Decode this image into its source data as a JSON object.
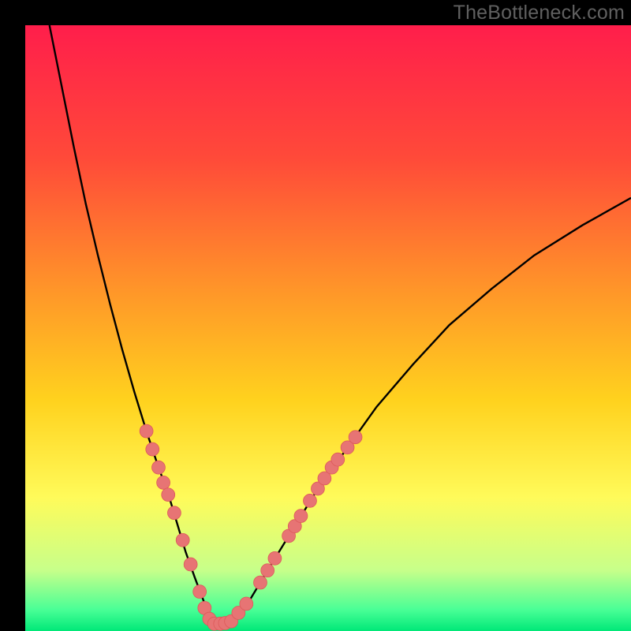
{
  "attribution": "TheBottleneck.com",
  "colors": {
    "frame": "#000000",
    "curve": "#000000",
    "dot_fill": "#e77474",
    "dot_stroke": "#dd5a5a",
    "gradient_stops": [
      {
        "offset": 0.0,
        "color": "#ff1e4b"
      },
      {
        "offset": 0.22,
        "color": "#ff4a39"
      },
      {
        "offset": 0.45,
        "color": "#ff9a28"
      },
      {
        "offset": 0.62,
        "color": "#ffd21e"
      },
      {
        "offset": 0.78,
        "color": "#fffb5a"
      },
      {
        "offset": 0.9,
        "color": "#c7ff8a"
      },
      {
        "offset": 0.965,
        "color": "#49ff96"
      },
      {
        "offset": 1.0,
        "color": "#00e878"
      }
    ]
  },
  "chart_data": {
    "type": "line",
    "title": "",
    "xlabel": "",
    "ylabel": "",
    "xlim": [
      0,
      100
    ],
    "ylim": [
      0,
      100
    ],
    "x": [
      4,
      6,
      8,
      10,
      12,
      14,
      16,
      18,
      20,
      22,
      23.5,
      25,
      26.5,
      28,
      30,
      32,
      34,
      37,
      40,
      44,
      48,
      53,
      58,
      64,
      70,
      77,
      84,
      92,
      100
    ],
    "values": [
      100,
      90,
      80,
      70.5,
      62,
      54,
      46.5,
      39.5,
      33,
      27,
      23,
      18,
      13,
      8.8,
      3.5,
      1.2,
      1.5,
      5,
      10,
      16.5,
      23,
      30,
      37,
      44,
      50.5,
      56.5,
      62,
      67,
      71.5
    ],
    "series": [
      {
        "name": "bottleneck-curve",
        "x": [
          4,
          6,
          8,
          10,
          12,
          14,
          16,
          18,
          20,
          22,
          23.5,
          25,
          26.5,
          28,
          30,
          32,
          34,
          37,
          40,
          44,
          48,
          53,
          58,
          64,
          70,
          77,
          84,
          92,
          100
        ],
        "values": [
          100,
          90,
          80,
          70.5,
          62,
          54,
          46.5,
          39.5,
          33,
          27,
          23,
          18,
          13,
          8.8,
          3.5,
          1.2,
          1.5,
          5,
          10,
          16.5,
          23,
          30,
          37,
          44,
          50.5,
          56.5,
          62,
          67,
          71.5
        ]
      }
    ],
    "dots": {
      "name": "highlighted-points",
      "points": [
        {
          "x": 20.0,
          "y": 33.0
        },
        {
          "x": 21.0,
          "y": 30.0
        },
        {
          "x": 22.0,
          "y": 27.0
        },
        {
          "x": 22.8,
          "y": 24.5
        },
        {
          "x": 23.6,
          "y": 22.5
        },
        {
          "x": 24.6,
          "y": 19.5
        },
        {
          "x": 26.0,
          "y": 15.0
        },
        {
          "x": 27.3,
          "y": 11.0
        },
        {
          "x": 28.8,
          "y": 6.5
        },
        {
          "x": 29.6,
          "y": 3.8
        },
        {
          "x": 30.4,
          "y": 2.0
        },
        {
          "x": 31.2,
          "y": 1.2
        },
        {
          "x": 32.2,
          "y": 1.2
        },
        {
          "x": 33.0,
          "y": 1.3
        },
        {
          "x": 34.0,
          "y": 1.6
        },
        {
          "x": 35.2,
          "y": 3.0
        },
        {
          "x": 36.5,
          "y": 4.5
        },
        {
          "x": 38.8,
          "y": 8.0
        },
        {
          "x": 40.0,
          "y": 10.0
        },
        {
          "x": 41.2,
          "y": 12.0
        },
        {
          "x": 43.5,
          "y": 15.7
        },
        {
          "x": 44.5,
          "y": 17.3
        },
        {
          "x": 45.5,
          "y": 19.0
        },
        {
          "x": 47.0,
          "y": 21.5
        },
        {
          "x": 48.3,
          "y": 23.5
        },
        {
          "x": 49.4,
          "y": 25.2
        },
        {
          "x": 50.6,
          "y": 27.0
        },
        {
          "x": 51.6,
          "y": 28.3
        },
        {
          "x": 53.2,
          "y": 30.3
        },
        {
          "x": 54.5,
          "y": 32.0
        }
      ]
    },
    "dot_radius": 1.1
  }
}
